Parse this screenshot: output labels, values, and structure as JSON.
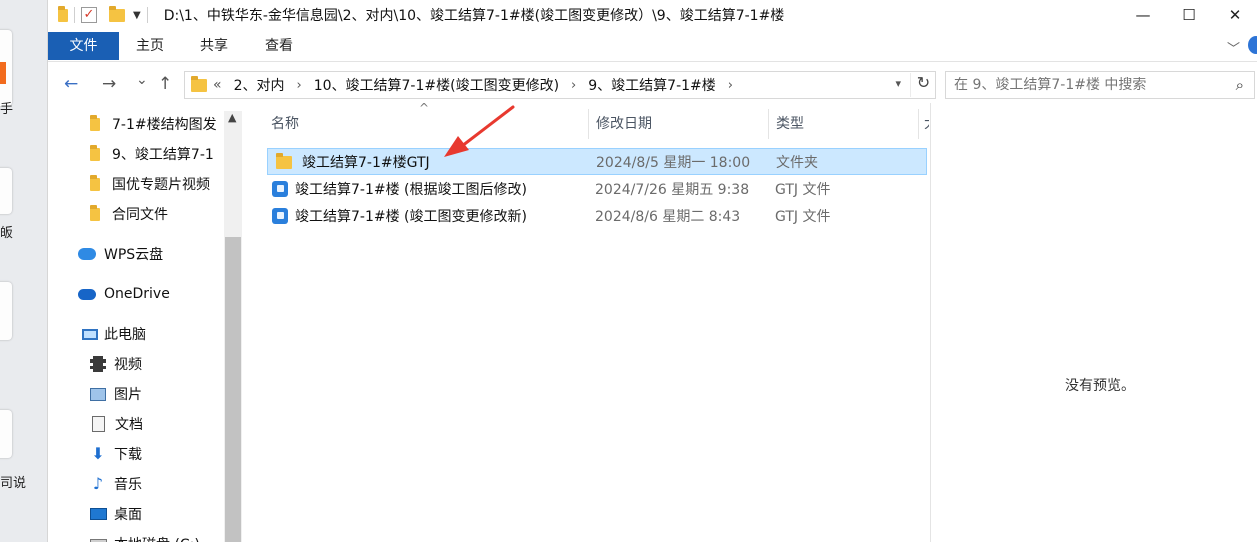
{
  "desktop": {
    "labels": [
      "手",
      "皈",
      "司说"
    ]
  },
  "window": {
    "title_path": "D:\\1、中铁华东-金华信息园\\2、对内\\10、竣工结算7-1#楼(竣工图变更修改）\\9、竣工结算7-1#楼",
    "controls": {
      "minimize": "—",
      "maximize": "☐",
      "close": "✕"
    }
  },
  "ribbon": {
    "tabs": [
      {
        "label": "文件",
        "active": true
      },
      {
        "label": "主页"
      },
      {
        "label": "共享"
      },
      {
        "label": "查看"
      }
    ],
    "expand_icon": "chevron-down-icon"
  },
  "navigation": {
    "back": "←",
    "forward": "→",
    "recent": "⌄",
    "up": "↑",
    "overflow": "«",
    "breadcrumbs": [
      "2、对内",
      "10、竣工结算7-1#楼(竣工图变更修改)",
      "9、竣工结算7-1#楼"
    ],
    "refresh": "↻",
    "search_placeholder": "在 9、竣工结算7-1#楼 中搜索"
  },
  "sidebar": {
    "items": [
      {
        "label": "7-1#楼结构图发",
        "icon": "folder-icon"
      },
      {
        "label": "9、竣工结算7-1",
        "icon": "folder-icon"
      },
      {
        "label": "国优专题片视频",
        "icon": "folder-icon"
      },
      {
        "label": "合同文件",
        "icon": "folder-icon"
      },
      {
        "label": "WPS云盘",
        "icon": "cloud-icon"
      },
      {
        "label": "OneDrive",
        "icon": "onedrive-icon"
      },
      {
        "label": "此电脑",
        "icon": "computer-icon"
      },
      {
        "label": "视频",
        "icon": "video-icon"
      },
      {
        "label": "图片",
        "icon": "picture-icon"
      },
      {
        "label": "文档",
        "icon": "document-icon"
      },
      {
        "label": "下载",
        "icon": "download-icon"
      },
      {
        "label": "音乐",
        "icon": "music-icon"
      },
      {
        "label": "桌面",
        "icon": "desktop-icon"
      },
      {
        "label": "本地磁盘 (C:)",
        "icon": "disk-icon"
      }
    ]
  },
  "filelist": {
    "columns": {
      "name": "名称",
      "date": "修改日期",
      "type": "类型",
      "size": "大"
    },
    "rows": [
      {
        "name": "竣工结算7-1#楼GTJ",
        "date": "2024/8/5 星期一 18:00",
        "type": "文件夹",
        "icon": "folder-icon",
        "selected": true
      },
      {
        "name": "竣工结算7-1#楼 (根据竣工图后修改)",
        "date": "2024/7/26 星期五 9:38",
        "type": "GTJ 文件",
        "icon": "gtj-file-icon",
        "selected": false
      },
      {
        "name": "竣工结算7-1#楼  (竣工图变更修改新)",
        "date": "2024/8/6 星期二 8:43",
        "type": "GTJ 文件",
        "icon": "gtj-file-icon",
        "selected": false
      }
    ]
  },
  "preview": {
    "message": "没有预览。"
  },
  "colors": {
    "accent": "#1a5fb4",
    "selection": "#cce8ff",
    "annotation_arrow": "#e8392f"
  }
}
